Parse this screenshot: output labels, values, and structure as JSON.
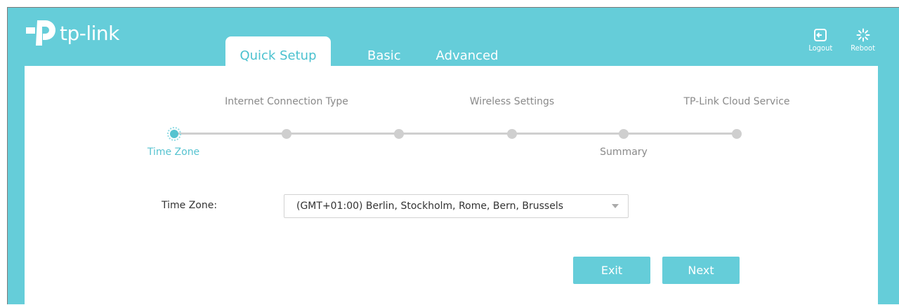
{
  "brand": {
    "name": "tp-link"
  },
  "tabs": [
    {
      "label": "Quick Setup",
      "active": true
    },
    {
      "label": "Basic",
      "active": false
    },
    {
      "label": "Advanced",
      "active": false
    }
  ],
  "top_actions": [
    {
      "label": "Logout",
      "icon": "logout-icon"
    },
    {
      "label": "Reboot",
      "icon": "reboot-icon"
    }
  ],
  "steps": [
    {
      "label": "Time Zone",
      "current": true
    },
    {
      "label": "Internet Connection Type",
      "current": false
    },
    {
      "label": "",
      "current": false
    },
    {
      "label": "Wireless Settings",
      "current": false
    },
    {
      "label": "Summary",
      "current": false
    },
    {
      "label": "TP-Link Cloud Service",
      "current": false
    }
  ],
  "form": {
    "time_zone_label": "Time Zone:",
    "time_zone_value": "(GMT+01:00) Berlin, Stockholm, Rome, Bern, Brussels"
  },
  "buttons": {
    "exit": "Exit",
    "next": "Next"
  },
  "colors": {
    "accent": "#65cdd9",
    "active_text": "#4ac1cf",
    "inactive": "#cfcfcf",
    "text": "#333333"
  }
}
